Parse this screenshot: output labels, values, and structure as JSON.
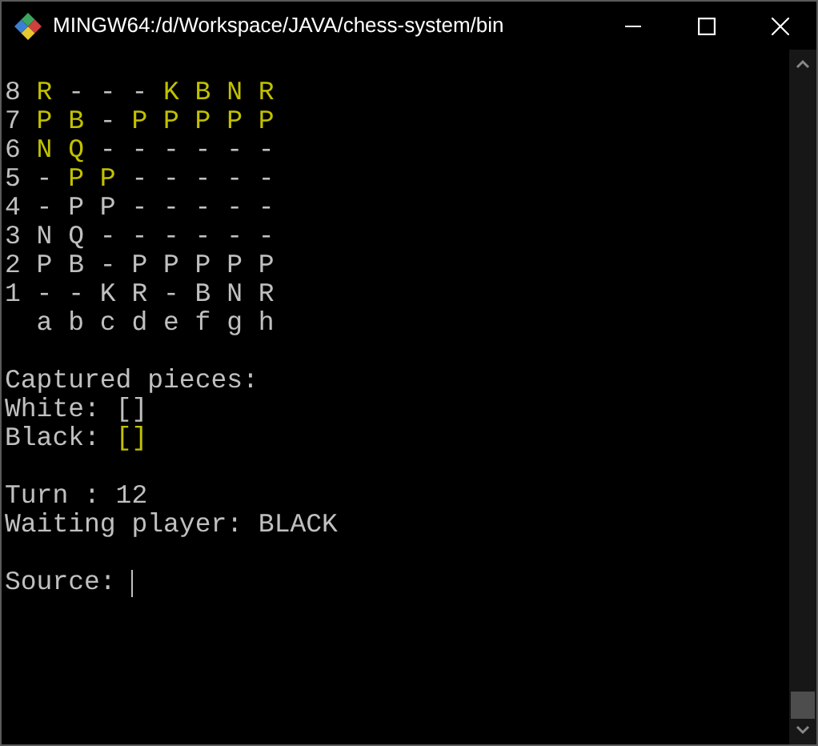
{
  "window": {
    "title": "MINGW64:/d/Workspace/JAVA/chess-system/bin"
  },
  "board": {
    "rows": [
      {
        "label": "8",
        "squares": [
          {
            "text": "R",
            "color": "#c1c100"
          },
          {
            "text": "-",
            "color": "#c0c0c0"
          },
          {
            "text": "-",
            "color": "#c0c0c0"
          },
          {
            "text": "-",
            "color": "#c0c0c0"
          },
          {
            "text": "K",
            "color": "#c1c100"
          },
          {
            "text": "B",
            "color": "#c1c100"
          },
          {
            "text": "N",
            "color": "#c1c100"
          },
          {
            "text": "R",
            "color": "#c1c100"
          }
        ]
      },
      {
        "label": "7",
        "squares": [
          {
            "text": "P",
            "color": "#c1c100"
          },
          {
            "text": "B",
            "color": "#c1c100"
          },
          {
            "text": "-",
            "color": "#c0c0c0"
          },
          {
            "text": "P",
            "color": "#c1c100"
          },
          {
            "text": "P",
            "color": "#c1c100"
          },
          {
            "text": "P",
            "color": "#c1c100"
          },
          {
            "text": "P",
            "color": "#c1c100"
          },
          {
            "text": "P",
            "color": "#c1c100"
          }
        ]
      },
      {
        "label": "6",
        "squares": [
          {
            "text": "N",
            "color": "#c1c100"
          },
          {
            "text": "Q",
            "color": "#c1c100"
          },
          {
            "text": "-",
            "color": "#c0c0c0"
          },
          {
            "text": "-",
            "color": "#c0c0c0"
          },
          {
            "text": "-",
            "color": "#c0c0c0"
          },
          {
            "text": "-",
            "color": "#c0c0c0"
          },
          {
            "text": "-",
            "color": "#c0c0c0"
          },
          {
            "text": "-",
            "color": "#c0c0c0"
          }
        ]
      },
      {
        "label": "5",
        "squares": [
          {
            "text": "-",
            "color": "#c0c0c0"
          },
          {
            "text": "P",
            "color": "#c1c100"
          },
          {
            "text": "P",
            "color": "#c1c100"
          },
          {
            "text": "-",
            "color": "#c0c0c0"
          },
          {
            "text": "-",
            "color": "#c0c0c0"
          },
          {
            "text": "-",
            "color": "#c0c0c0"
          },
          {
            "text": "-",
            "color": "#c0c0c0"
          },
          {
            "text": "-",
            "color": "#c0c0c0"
          }
        ]
      },
      {
        "label": "4",
        "squares": [
          {
            "text": "-",
            "color": "#c0c0c0"
          },
          {
            "text": "P",
            "color": "#c0c0c0"
          },
          {
            "text": "P",
            "color": "#c0c0c0"
          },
          {
            "text": "-",
            "color": "#c0c0c0"
          },
          {
            "text": "-",
            "color": "#c0c0c0"
          },
          {
            "text": "-",
            "color": "#c0c0c0"
          },
          {
            "text": "-",
            "color": "#c0c0c0"
          },
          {
            "text": "-",
            "color": "#c0c0c0"
          }
        ]
      },
      {
        "label": "3",
        "squares": [
          {
            "text": "N",
            "color": "#c0c0c0"
          },
          {
            "text": "Q",
            "color": "#c0c0c0"
          },
          {
            "text": "-",
            "color": "#c0c0c0"
          },
          {
            "text": "-",
            "color": "#c0c0c0"
          },
          {
            "text": "-",
            "color": "#c0c0c0"
          },
          {
            "text": "-",
            "color": "#c0c0c0"
          },
          {
            "text": "-",
            "color": "#c0c0c0"
          },
          {
            "text": "-",
            "color": "#c0c0c0"
          }
        ]
      },
      {
        "label": "2",
        "squares": [
          {
            "text": "P",
            "color": "#c0c0c0"
          },
          {
            "text": "B",
            "color": "#c0c0c0"
          },
          {
            "text": "-",
            "color": "#c0c0c0"
          },
          {
            "text": "P",
            "color": "#c0c0c0"
          },
          {
            "text": "P",
            "color": "#c0c0c0"
          },
          {
            "text": "P",
            "color": "#c0c0c0"
          },
          {
            "text": "P",
            "color": "#c0c0c0"
          },
          {
            "text": "P",
            "color": "#c0c0c0"
          }
        ]
      },
      {
        "label": "1",
        "squares": [
          {
            "text": "-",
            "color": "#c0c0c0"
          },
          {
            "text": "-",
            "color": "#c0c0c0"
          },
          {
            "text": "K",
            "color": "#c0c0c0"
          },
          {
            "text": "R",
            "color": "#c0c0c0"
          },
          {
            "text": "-",
            "color": "#c0c0c0"
          },
          {
            "text": "B",
            "color": "#c0c0c0"
          },
          {
            "text": "N",
            "color": "#c0c0c0"
          },
          {
            "text": "R",
            "color": "#c0c0c0"
          }
        ]
      }
    ],
    "files": [
      "a",
      "b",
      "c",
      "d",
      "e",
      "f",
      "g",
      "h"
    ]
  },
  "captured": {
    "heading": "Captured pieces:",
    "sides": [
      {
        "label": "White:",
        "value": "[]",
        "color": "#c0c0c0"
      },
      {
        "label": "Black:",
        "value": "[]",
        "color": "#c1c100"
      }
    ]
  },
  "turn": "Turn : 12",
  "waiting": "Waiting player: BLACK",
  "prompt": "Source:"
}
